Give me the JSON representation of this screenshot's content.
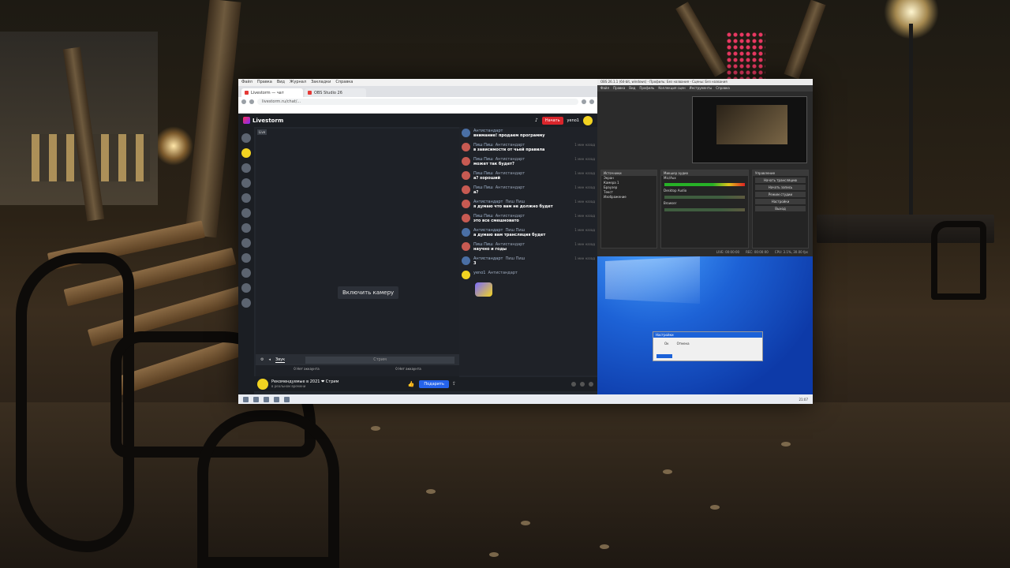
{
  "browser": {
    "menu": [
      "Файл",
      "Правка",
      "Вид",
      "Журнал",
      "Закладки",
      "Справка"
    ],
    "tabs": [
      {
        "label": "Livestorm — чат"
      },
      {
        "label": "OBS Studio 26"
      }
    ],
    "url": "livestorm.ru/chat/..."
  },
  "app": {
    "logo": "Livestorm",
    "start_button": "Начать",
    "user_name": "yeno1",
    "live_tag": "Live",
    "enable_camera": "Включить камеру",
    "tabs": {
      "sound": "Звук",
      "input_placeholder": "Стрим"
    },
    "counts": {
      "left": "0 Нет аккаунта",
      "right": "0 Нет аккаунта"
    },
    "footer": {
      "title": "Рекомендуемые в 2021 ❤ Стрим",
      "subtitle": "в реальном времени",
      "button": "Подарить"
    }
  },
  "chat": [
    {
      "who": "Антистандарт",
      "to": "",
      "time": "",
      "text": "внимание! продаем программу",
      "avatar": "blue"
    },
    {
      "who": "Пиш Пиш",
      "to": "Антистандарт",
      "time": "1 мин назад",
      "text": "в зависимости от чьей правила",
      "avatar": "red"
    },
    {
      "who": "Пиш Пиш",
      "to": "Антистандарт",
      "time": "1 мин назад",
      "text": "может так будет?",
      "avatar": "red"
    },
    {
      "who": "Пиш Пиш",
      "to": "Антистандарт",
      "time": "1 мин назад",
      "text": "а? хороший",
      "avatar": "red"
    },
    {
      "who": "Пиш Пиш",
      "to": "Антистандарт",
      "time": "1 мин назад",
      "text": "а?",
      "avatar": "red"
    },
    {
      "who": "Антистандарт",
      "to": "Пиш Пиш",
      "time": "1 мин назад",
      "text": "я думаю что вам не должно будет",
      "avatar": "red"
    },
    {
      "who": "Пиш Пиш",
      "to": "Антистандарт",
      "time": "1 мин назад",
      "text": "это все смешновато",
      "avatar": "red"
    },
    {
      "who": "Антистандарт",
      "to": "Пиш Пиш",
      "time": "1 мин назад",
      "text": "а думаю вам трансляция будет",
      "avatar": "blue"
    },
    {
      "who": "Пиш Пиш",
      "to": "Антистандарт",
      "time": "1 мин назад",
      "text": "научно и годы",
      "avatar": "red"
    },
    {
      "who": "Антистандарт",
      "to": "Пиш Пиш",
      "time": "1 мин назад",
      "text": "3",
      "avatar": "blue"
    },
    {
      "who": "yeno1",
      "to": "Антистандарт",
      "time": "",
      "text": "",
      "avatar": "y"
    }
  ],
  "obs": {
    "title": "OBS 26.1.1 (64-bit, windows) - Профиль: Без названия - Сцены: Без названия",
    "menu": [
      "Файл",
      "Правка",
      "Вид",
      "Профиль",
      "Коллекция сцен",
      "Инструменты",
      "Справка"
    ],
    "panels": {
      "scenes": "Источники",
      "mixer": "Микшер аудио",
      "controls": "Управление"
    },
    "sources": [
      "Экран",
      "Камера 1",
      "Браузер",
      "Текст",
      "Изображение"
    ],
    "controls": [
      "Начать трансляцию",
      "Начать запись",
      "Режим студии",
      "Настройки",
      "Выход"
    ],
    "mixer": [
      "Mic/Aux",
      "Desktop Audio",
      "Browser"
    ],
    "status": [
      "LIVE: 00:00:00",
      "REC: 00:00:00",
      "CPU: 3.1%, 30.00 fps"
    ]
  },
  "dialog": {
    "title": "Настройки",
    "fields": [
      "Ок",
      "Отмена"
    ]
  },
  "taskbar": {
    "clock": "21:07"
  },
  "colors": {
    "accent_red": "#d9252b",
    "accent_blue": "#2563eb",
    "desktop_blue": "#1d62d6"
  }
}
